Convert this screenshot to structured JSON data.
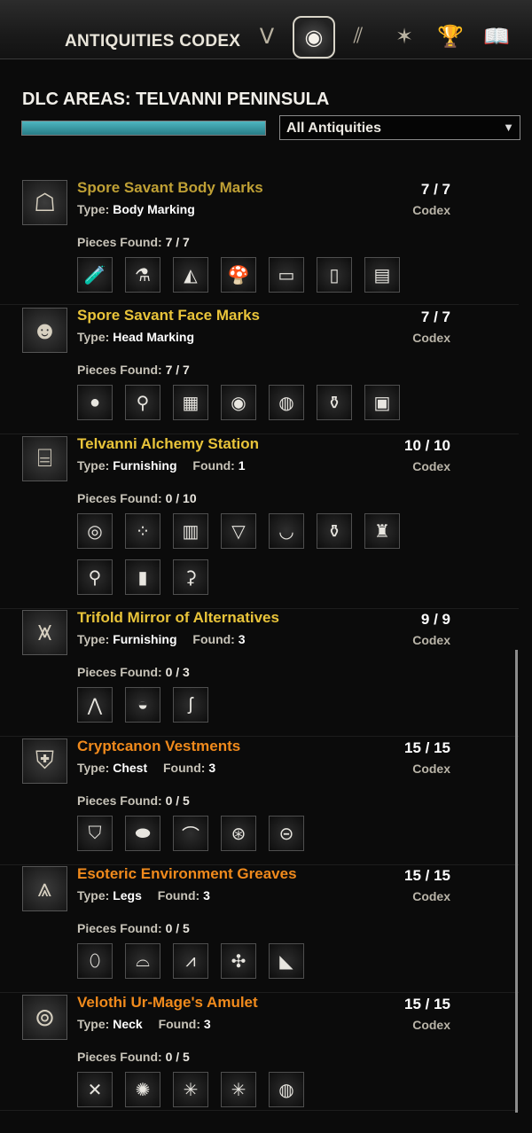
{
  "header": {
    "title": "ANTIQUITIES CODEX",
    "nav_icons": [
      "lead-icon",
      "codex-icon",
      "scrying-icon",
      "compass-icon",
      "trophy-icon",
      "journal-icon"
    ]
  },
  "zone": {
    "title": "DLC AREAS: TELVANNI PENINSULA",
    "progress_percent": 100
  },
  "filter": {
    "selected": "All Antiquities",
    "arrow": "▼"
  },
  "labels": {
    "type": "Type:",
    "found": "Found:",
    "pieces_found": "Pieces Found:",
    "codex": "Codex"
  },
  "colors": {
    "gold": "#c9a533",
    "yellow": "#e9c43a",
    "orange": "#f08a1c",
    "teal": "#3ea5b0"
  },
  "entries": [
    {
      "name": "Spore Savant Body Marks",
      "type": "Body Marking",
      "found": "",
      "pieces": "7 / 7",
      "codex": "7 / 7",
      "color": "#bfa035",
      "thumb": "☖",
      "slots": [
        "🧪",
        "⚗",
        "◭",
        "🍄",
        "▭",
        "▯",
        "▤"
      ]
    },
    {
      "name": "Spore Savant Face Marks",
      "type": "Head Marking",
      "found": "",
      "pieces": "7 / 7",
      "codex": "7 / 7",
      "color": "#e9c43a",
      "thumb": "☻",
      "slots": [
        "●",
        "⚲",
        "▦",
        "◉",
        "◍",
        "⚱",
        "▣"
      ]
    },
    {
      "name": "Telvanni Alchemy Station",
      "type": "Furnishing",
      "found": "1",
      "pieces": "0 / 10",
      "codex": "10 / 10",
      "color": "#e9c43a",
      "thumb": "⌸",
      "slots": [
        "◎",
        "⁘",
        "▥",
        "▽",
        "◡",
        "⚱",
        "♜",
        "⚲",
        "▮",
        "⚳"
      ]
    },
    {
      "name": "Trifold Mirror of Alternatives",
      "type": "Furnishing",
      "found": "3",
      "pieces": "0 / 3",
      "codex": "9 / 9",
      "color": "#e9c43a",
      "thumb": "⩙",
      "slots": [
        "⋀",
        "◒",
        "ʃ"
      ]
    },
    {
      "name": "Cryptcanon Vestments",
      "type": "Chest",
      "found": "3",
      "pieces": "0 / 5",
      "codex": "15 / 15",
      "color": "#f08a1c",
      "thumb": "⛨",
      "slots": [
        "⛉",
        "⬬",
        "⌒",
        "⊛",
        "⊝"
      ]
    },
    {
      "name": "Esoteric Environment Greaves",
      "type": "Legs",
      "found": "3",
      "pieces": "0 / 5",
      "codex": "15 / 15",
      "color": "#f08a1c",
      "thumb": "⩓",
      "slots": [
        "⬯",
        "⌓",
        "⩘",
        "✣",
        "◣"
      ]
    },
    {
      "name": "Velothi Ur-Mage's Amulet",
      "type": "Neck",
      "found": "3",
      "pieces": "0 / 5",
      "codex": "15 / 15",
      "color": "#f08a1c",
      "thumb": "⊚",
      "slots": [
        "✕",
        "✺",
        "✳",
        "✳",
        "◍"
      ]
    }
  ]
}
